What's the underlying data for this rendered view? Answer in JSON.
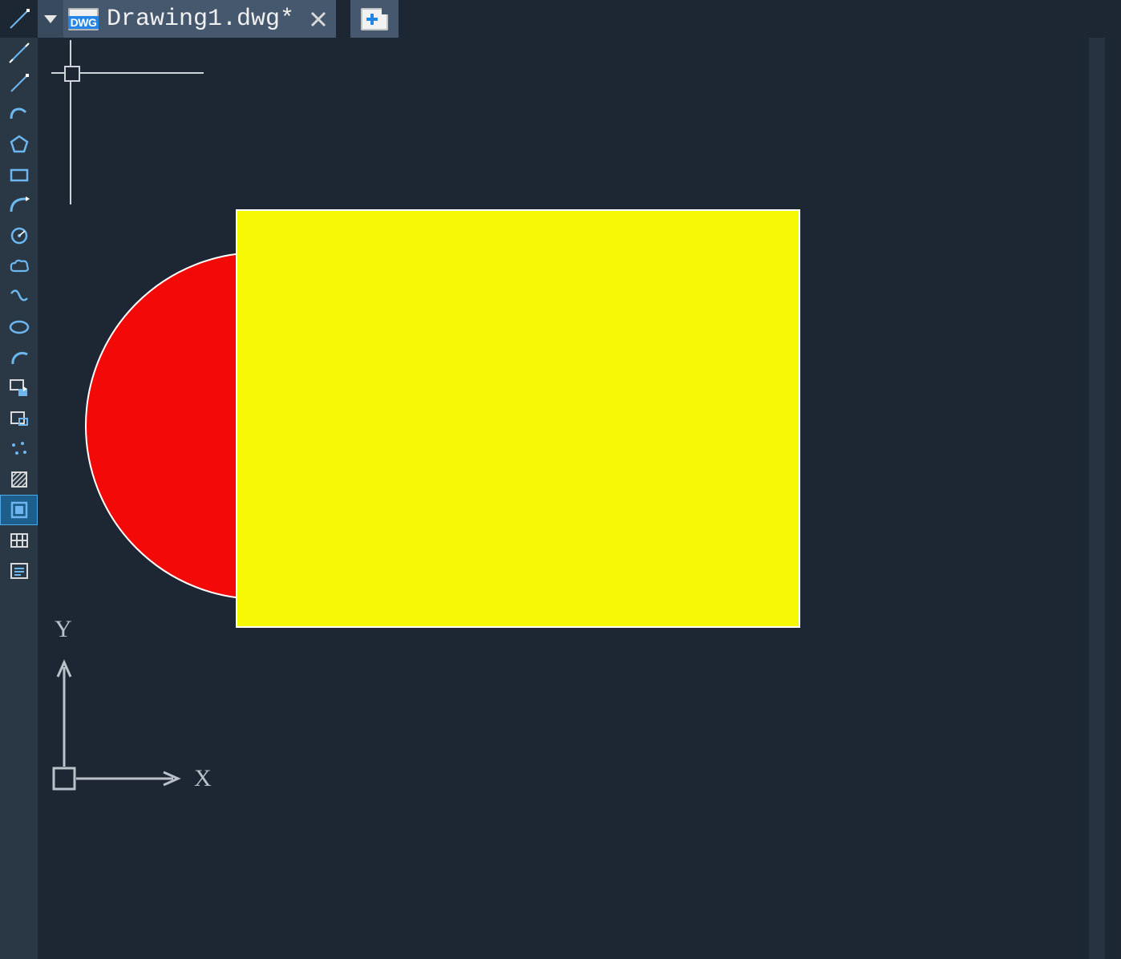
{
  "tabbar": {
    "filetype_badge": "DWG",
    "active_title": "Drawing1.dwg*"
  },
  "ucs": {
    "xlabel": "X",
    "ylabel": "Y"
  },
  "tools": [
    {
      "name": "construction-line-tool"
    },
    {
      "name": "ray-tool"
    },
    {
      "name": "polyline-tool"
    },
    {
      "name": "polygon-tool"
    },
    {
      "name": "rectangle-tool"
    },
    {
      "name": "arc-arrow-tool"
    },
    {
      "name": "circle-center-tool"
    },
    {
      "name": "revision-cloud-tool"
    },
    {
      "name": "spline-tool"
    },
    {
      "name": "ellipse-tool"
    },
    {
      "name": "arc-tool"
    },
    {
      "name": "insert-block-tool"
    },
    {
      "name": "make-block-tool"
    },
    {
      "name": "point-tool"
    },
    {
      "name": "hatch-tool"
    },
    {
      "name": "region-tool"
    },
    {
      "name": "table-tool"
    },
    {
      "name": "text-tool"
    }
  ],
  "shapes": {
    "circle": {
      "color": "#f30908"
    },
    "rectangle": {
      "color": "#f6f804"
    }
  },
  "colors": {
    "accent": "#2585e6",
    "bg": "#1d2733",
    "panel": "#2a3745",
    "tab_active": "#46586d"
  }
}
